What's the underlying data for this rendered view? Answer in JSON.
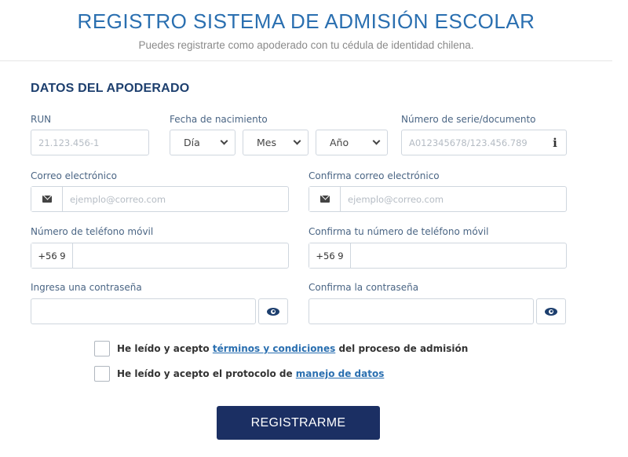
{
  "header": {
    "title": "REGISTRO SISTEMA DE ADMISIÓN ESCOLAR",
    "subtitle": "Puedes registrarte como apoderado con tu cédula de identidad chilena."
  },
  "section": {
    "title": "DATOS DEL APODERADO"
  },
  "run": {
    "label": "RUN",
    "placeholder": "21.123.456-1",
    "value": ""
  },
  "birthdate": {
    "label": "Fecha de nacimiento",
    "day": "Día",
    "month": "Mes",
    "year": "Año"
  },
  "document": {
    "label": "Número de serie/documento",
    "placeholder": "A012345678/123.456.789",
    "info_icon": "info-icon"
  },
  "email": {
    "label": "Correo electrónico",
    "placeholder": "ejemplo@correo.com",
    "icon": "envelope-icon"
  },
  "email_confirm": {
    "label": "Confirma correo electrónico",
    "placeholder": "ejemplo@correo.com",
    "icon": "envelope-icon"
  },
  "phone": {
    "label": "Número de teléfono móvil",
    "prefix": "+56 9",
    "value": ""
  },
  "phone_confirm": {
    "label": "Confirma tu número de teléfono móvil",
    "prefix": "+56 9",
    "value": ""
  },
  "password": {
    "label": "Ingresa una contraseña",
    "value": "",
    "icon": "eye-icon"
  },
  "password_confirm": {
    "label": "Confirma la contraseña",
    "value": "",
    "icon": "eye-icon"
  },
  "terms": {
    "prefix": "He leído y acepto ",
    "link": "términos y condiciones",
    "suffix": " del proceso de admisión"
  },
  "data_policy": {
    "prefix": "He leído y acepto el protocolo de ",
    "link": "manejo de datos"
  },
  "submit": {
    "label": "REGISTRARME"
  },
  "colors": {
    "title": "#2a6fb0",
    "section_title": "#1d3f6e",
    "button_bg": "#1b2f63",
    "link": "#2a6fb0",
    "label": "#4a6584"
  }
}
